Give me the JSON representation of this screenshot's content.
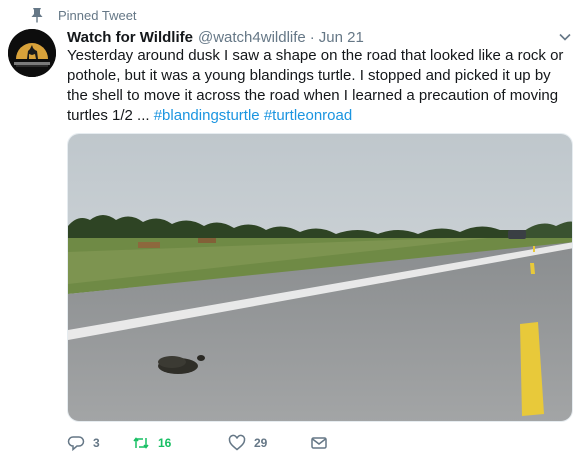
{
  "pinned": {
    "label": "Pinned Tweet"
  },
  "tweet": {
    "author_name": "Watch for Wildlife",
    "handle": "@watch4wildlife",
    "separator": "·",
    "date": "Jun 21",
    "text_main": "Yesterday around dusk I saw a shape on the road that looked like a rock or pothole, but it was a young blandings turtle. I stopped and picked it up by the shell to move it across the road when I learned a precaution of moving turtles 1/2 ...",
    "hashtags": [
      "#blandingsturtle",
      "#turtleonroad"
    ],
    "media_icons": [
      "turtle-on-road-photo"
    ]
  },
  "actions": {
    "reply_count": "3",
    "retweet_count": "16",
    "like_count": "29"
  },
  "colors": {
    "link": "#1b95e0",
    "retweet_active": "#17bf63",
    "muted": "#657786"
  }
}
